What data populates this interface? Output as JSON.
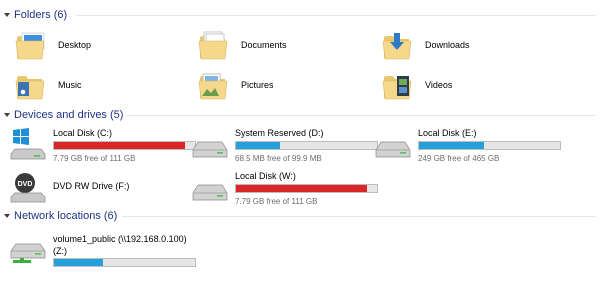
{
  "folders": {
    "title": "Folders (6)",
    "items": [
      {
        "label": "Desktop"
      },
      {
        "label": "Documents"
      },
      {
        "label": "Downloads"
      },
      {
        "label": "Music"
      },
      {
        "label": "Pictures"
      },
      {
        "label": "Videos"
      }
    ]
  },
  "devices": {
    "title": "Devices and drives (5)",
    "items": [
      {
        "name": "Local Disk (C:)",
        "free": "7.79 GB free of 111 GB",
        "used_fraction": 0.93,
        "bar_color": "#da2626"
      },
      {
        "name": "System Reserved (D:)",
        "free": "68.5 MB free of 99.9 MB",
        "used_fraction": 0.31,
        "bar_color": "#26a0da"
      },
      {
        "name": "Local Disk (E:)",
        "free": "249 GB free of 465 GB",
        "used_fraction": 0.46,
        "bar_color": "#26a0da"
      },
      {
        "name": "DVD RW Drive (F:)"
      },
      {
        "name": "Local Disk (W:)",
        "free": "7.79 GB free of 111 GB",
        "used_fraction": 0.93,
        "bar_color": "#da2626"
      }
    ]
  },
  "network": {
    "title": "Network locations (6)",
    "items": [
      {
        "name_line1": "volume1_public (\\\\192.168.0.100)",
        "name_line2": "(Z:)",
        "used_fraction": 0.35,
        "bar_color": "#26a0da"
      }
    ]
  }
}
